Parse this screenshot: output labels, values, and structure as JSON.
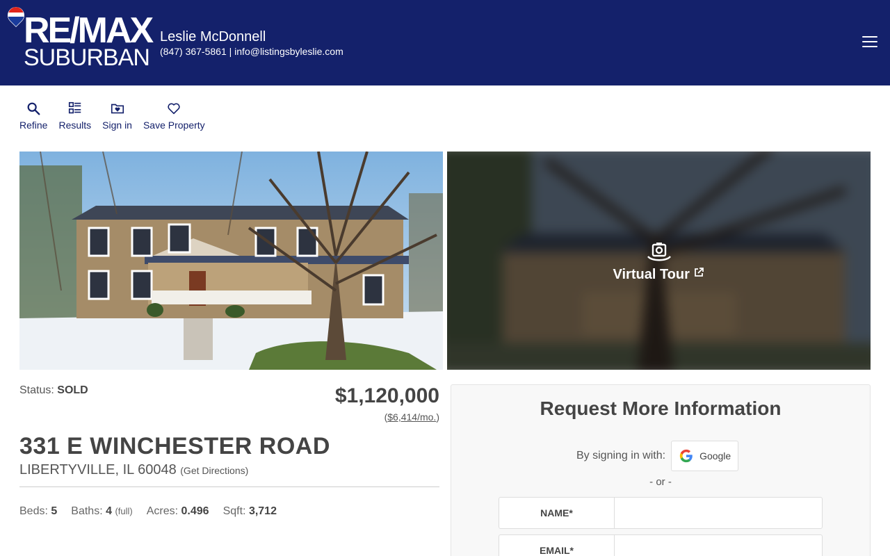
{
  "brand": {
    "line1": "RE/MAX",
    "line2": "SUBURBAN",
    "color_primary": "#14216b"
  },
  "agent": {
    "name": "Leslie McDonnell",
    "contact": "(847) 367-5861 | info@listingsbyleslie.com"
  },
  "toolbar": [
    {
      "label": "Refine",
      "icon": "search-icon"
    },
    {
      "label": "Results",
      "icon": "results-list-icon"
    },
    {
      "label": "Sign in",
      "icon": "folder-heart-icon"
    },
    {
      "label": "Save Property",
      "icon": "heart-icon"
    }
  ],
  "tour": {
    "label": "Virtual Tour"
  },
  "listing": {
    "status_label": "Status:",
    "status": "SOLD",
    "price": "$1,120,000",
    "monthly": "$6,414/mo.",
    "address": "331 E WINCHESTER ROAD",
    "city": "LIBERTYVILLE, IL 60048",
    "directions": "(Get Directions)",
    "beds_label": "Beds:",
    "beds": "5",
    "baths_label": "Baths:",
    "baths": "4",
    "baths_note": "(full)",
    "acres_label": "Acres:",
    "acres": "0.496",
    "sqft_label": "Sqft:",
    "sqft": "3,712"
  },
  "form": {
    "title": "Request More Information",
    "signin_text": "By signing in with:",
    "google": "Google",
    "or": "- or -",
    "name_label": "NAME*",
    "email_label": "EMAIL*"
  }
}
